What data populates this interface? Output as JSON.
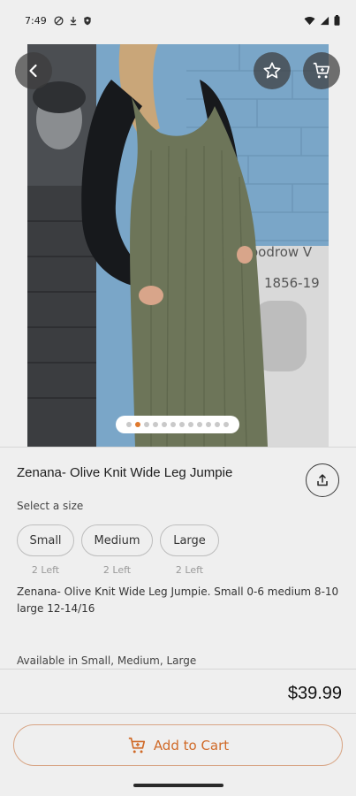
{
  "status_bar": {
    "time": "7:49"
  },
  "product": {
    "title": "Zenana- Olive Knit Wide Leg Jumpie",
    "size_prompt": "Select a size",
    "sizes": [
      {
        "label": "Small",
        "stock": "2 Left"
      },
      {
        "label": "Medium",
        "stock": "2 Left"
      },
      {
        "label": "Large",
        "stock": "2 Left"
      }
    ],
    "description": "Zenana- Olive Knit Wide Leg Jumpie. Small 0-6 medium 8-10 large 12-14/16",
    "availability": "Available in Small, Medium, Large",
    "price": "$39.99"
  },
  "actions": {
    "add_to_cart": "Add to Cart"
  },
  "carousel": {
    "total": 12,
    "active_index": 1
  },
  "colors": {
    "accent": "#d06a28",
    "overlay_button": "#3c3c3c"
  },
  "icons": [
    "back-arrow-icon",
    "star-icon",
    "cart-icon",
    "share-icon"
  ]
}
